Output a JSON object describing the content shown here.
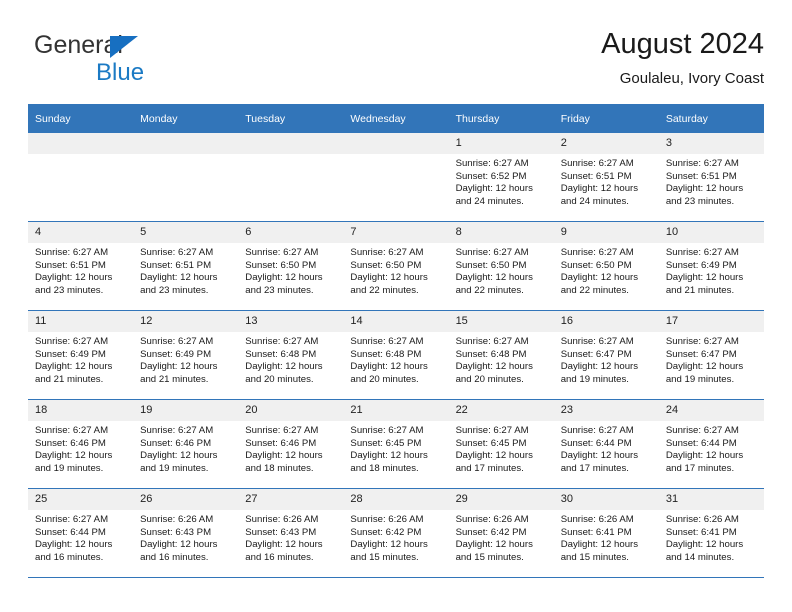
{
  "brand": {
    "name_part1": "General",
    "name_part2": "Blue",
    "logo_icon": "triangle-logo-icon"
  },
  "header": {
    "title": "August 2024",
    "subtitle": "Goulaleu, Ivory Coast"
  },
  "colors": {
    "header_blue": "#3275b9",
    "brand_blue": "#1b7ac4",
    "daynum_bg": "#f0f0f0",
    "text": "#1a1a1a"
  },
  "calendar": {
    "weekday_headers": [
      "Sunday",
      "Monday",
      "Tuesday",
      "Wednesday",
      "Thursday",
      "Friday",
      "Saturday"
    ],
    "weeks": [
      [
        {
          "day": "",
          "empty": true
        },
        {
          "day": "",
          "empty": true
        },
        {
          "day": "",
          "empty": true
        },
        {
          "day": "",
          "empty": true
        },
        {
          "day": "1",
          "sunrise": "Sunrise: 6:27 AM",
          "sunset": "Sunset: 6:52 PM",
          "daylight1": "Daylight: 12 hours",
          "daylight2": "and 24 minutes."
        },
        {
          "day": "2",
          "sunrise": "Sunrise: 6:27 AM",
          "sunset": "Sunset: 6:51 PM",
          "daylight1": "Daylight: 12 hours",
          "daylight2": "and 24 minutes."
        },
        {
          "day": "3",
          "sunrise": "Sunrise: 6:27 AM",
          "sunset": "Sunset: 6:51 PM",
          "daylight1": "Daylight: 12 hours",
          "daylight2": "and 23 minutes."
        }
      ],
      [
        {
          "day": "4",
          "sunrise": "Sunrise: 6:27 AM",
          "sunset": "Sunset: 6:51 PM",
          "daylight1": "Daylight: 12 hours",
          "daylight2": "and 23 minutes."
        },
        {
          "day": "5",
          "sunrise": "Sunrise: 6:27 AM",
          "sunset": "Sunset: 6:51 PM",
          "daylight1": "Daylight: 12 hours",
          "daylight2": "and 23 minutes."
        },
        {
          "day": "6",
          "sunrise": "Sunrise: 6:27 AM",
          "sunset": "Sunset: 6:50 PM",
          "daylight1": "Daylight: 12 hours",
          "daylight2": "and 23 minutes."
        },
        {
          "day": "7",
          "sunrise": "Sunrise: 6:27 AM",
          "sunset": "Sunset: 6:50 PM",
          "daylight1": "Daylight: 12 hours",
          "daylight2": "and 22 minutes."
        },
        {
          "day": "8",
          "sunrise": "Sunrise: 6:27 AM",
          "sunset": "Sunset: 6:50 PM",
          "daylight1": "Daylight: 12 hours",
          "daylight2": "and 22 minutes."
        },
        {
          "day": "9",
          "sunrise": "Sunrise: 6:27 AM",
          "sunset": "Sunset: 6:50 PM",
          "daylight1": "Daylight: 12 hours",
          "daylight2": "and 22 minutes."
        },
        {
          "day": "10",
          "sunrise": "Sunrise: 6:27 AM",
          "sunset": "Sunset: 6:49 PM",
          "daylight1": "Daylight: 12 hours",
          "daylight2": "and 21 minutes."
        }
      ],
      [
        {
          "day": "11",
          "sunrise": "Sunrise: 6:27 AM",
          "sunset": "Sunset: 6:49 PM",
          "daylight1": "Daylight: 12 hours",
          "daylight2": "and 21 minutes."
        },
        {
          "day": "12",
          "sunrise": "Sunrise: 6:27 AM",
          "sunset": "Sunset: 6:49 PM",
          "daylight1": "Daylight: 12 hours",
          "daylight2": "and 21 minutes."
        },
        {
          "day": "13",
          "sunrise": "Sunrise: 6:27 AM",
          "sunset": "Sunset: 6:48 PM",
          "daylight1": "Daylight: 12 hours",
          "daylight2": "and 20 minutes."
        },
        {
          "day": "14",
          "sunrise": "Sunrise: 6:27 AM",
          "sunset": "Sunset: 6:48 PM",
          "daylight1": "Daylight: 12 hours",
          "daylight2": "and 20 minutes."
        },
        {
          "day": "15",
          "sunrise": "Sunrise: 6:27 AM",
          "sunset": "Sunset: 6:48 PM",
          "daylight1": "Daylight: 12 hours",
          "daylight2": "and 20 minutes."
        },
        {
          "day": "16",
          "sunrise": "Sunrise: 6:27 AM",
          "sunset": "Sunset: 6:47 PM",
          "daylight1": "Daylight: 12 hours",
          "daylight2": "and 19 minutes."
        },
        {
          "day": "17",
          "sunrise": "Sunrise: 6:27 AM",
          "sunset": "Sunset: 6:47 PM",
          "daylight1": "Daylight: 12 hours",
          "daylight2": "and 19 minutes."
        }
      ],
      [
        {
          "day": "18",
          "sunrise": "Sunrise: 6:27 AM",
          "sunset": "Sunset: 6:46 PM",
          "daylight1": "Daylight: 12 hours",
          "daylight2": "and 19 minutes."
        },
        {
          "day": "19",
          "sunrise": "Sunrise: 6:27 AM",
          "sunset": "Sunset: 6:46 PM",
          "daylight1": "Daylight: 12 hours",
          "daylight2": "and 19 minutes."
        },
        {
          "day": "20",
          "sunrise": "Sunrise: 6:27 AM",
          "sunset": "Sunset: 6:46 PM",
          "daylight1": "Daylight: 12 hours",
          "daylight2": "and 18 minutes."
        },
        {
          "day": "21",
          "sunrise": "Sunrise: 6:27 AM",
          "sunset": "Sunset: 6:45 PM",
          "daylight1": "Daylight: 12 hours",
          "daylight2": "and 18 minutes."
        },
        {
          "day": "22",
          "sunrise": "Sunrise: 6:27 AM",
          "sunset": "Sunset: 6:45 PM",
          "daylight1": "Daylight: 12 hours",
          "daylight2": "and 17 minutes."
        },
        {
          "day": "23",
          "sunrise": "Sunrise: 6:27 AM",
          "sunset": "Sunset: 6:44 PM",
          "daylight1": "Daylight: 12 hours",
          "daylight2": "and 17 minutes."
        },
        {
          "day": "24",
          "sunrise": "Sunrise: 6:27 AM",
          "sunset": "Sunset: 6:44 PM",
          "daylight1": "Daylight: 12 hours",
          "daylight2": "and 17 minutes."
        }
      ],
      [
        {
          "day": "25",
          "sunrise": "Sunrise: 6:27 AM",
          "sunset": "Sunset: 6:44 PM",
          "daylight1": "Daylight: 12 hours",
          "daylight2": "and 16 minutes."
        },
        {
          "day": "26",
          "sunrise": "Sunrise: 6:26 AM",
          "sunset": "Sunset: 6:43 PM",
          "daylight1": "Daylight: 12 hours",
          "daylight2": "and 16 minutes."
        },
        {
          "day": "27",
          "sunrise": "Sunrise: 6:26 AM",
          "sunset": "Sunset: 6:43 PM",
          "daylight1": "Daylight: 12 hours",
          "daylight2": "and 16 minutes."
        },
        {
          "day": "28",
          "sunrise": "Sunrise: 6:26 AM",
          "sunset": "Sunset: 6:42 PM",
          "daylight1": "Daylight: 12 hours",
          "daylight2": "and 15 minutes."
        },
        {
          "day": "29",
          "sunrise": "Sunrise: 6:26 AM",
          "sunset": "Sunset: 6:42 PM",
          "daylight1": "Daylight: 12 hours",
          "daylight2": "and 15 minutes."
        },
        {
          "day": "30",
          "sunrise": "Sunrise: 6:26 AM",
          "sunset": "Sunset: 6:41 PM",
          "daylight1": "Daylight: 12 hours",
          "daylight2": "and 15 minutes."
        },
        {
          "day": "31",
          "sunrise": "Sunrise: 6:26 AM",
          "sunset": "Sunset: 6:41 PM",
          "daylight1": "Daylight: 12 hours",
          "daylight2": "and 14 minutes."
        }
      ]
    ]
  }
}
